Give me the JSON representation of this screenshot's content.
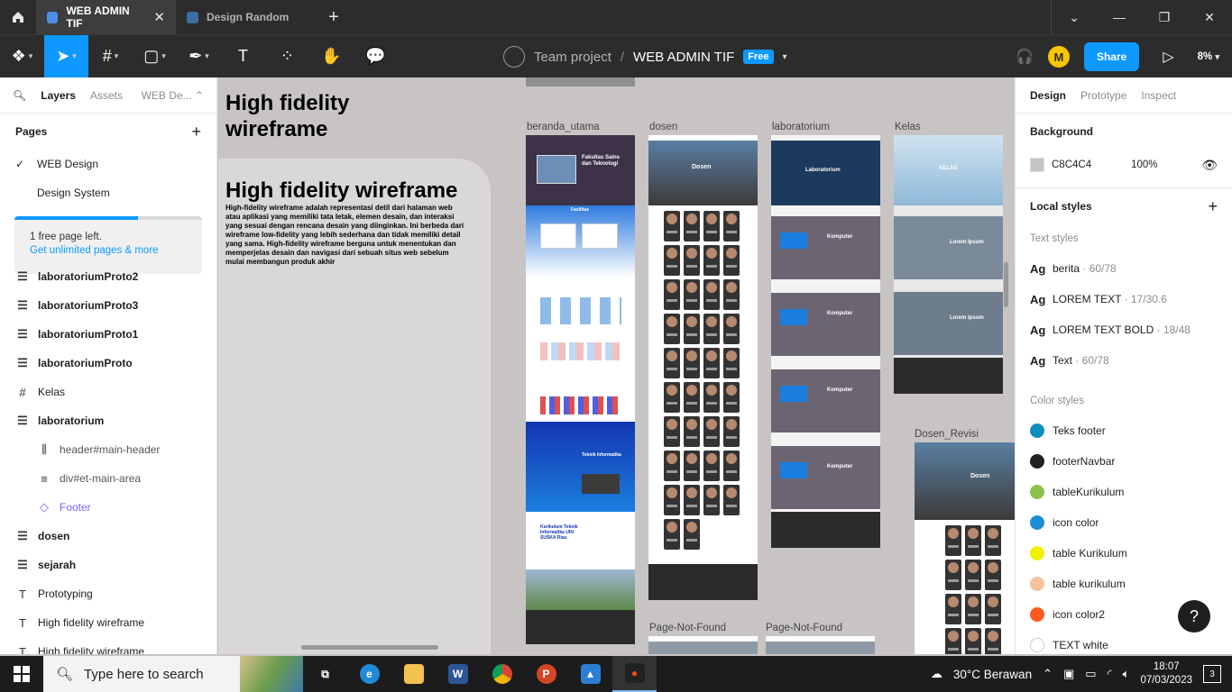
{
  "tabs": [
    {
      "label": "WEB ADMIN TIF",
      "active": true
    },
    {
      "label": "Design Random",
      "active": false
    }
  ],
  "toolbar": {
    "team": "Team project",
    "separator": "/",
    "file": "WEB ADMIN TIF",
    "plan_badge": "Free",
    "user_initial": "M",
    "share_label": "Share",
    "zoom": "8%"
  },
  "left_panel": {
    "tab_layers": "Layers",
    "tab_assets": "Assets",
    "page_dropdown": "WEB De...",
    "pages_heading": "Pages",
    "pages": [
      {
        "label": "WEB Design",
        "current": true
      },
      {
        "label": "Design System",
        "current": false
      }
    ],
    "banner_text": "1 free page left.",
    "banner_link": "Get unlimited pages & more",
    "banner_progress": 0.66,
    "layers": [
      {
        "label": "laboratoriumProto2",
        "icon": "frame-lines-icon",
        "kind": "bold"
      },
      {
        "label": "laboratoriumProto3",
        "icon": "frame-lines-icon",
        "kind": "bold"
      },
      {
        "label": "laboratoriumProto1",
        "icon": "frame-lines-icon",
        "kind": "bold"
      },
      {
        "label": "laboratoriumProto",
        "icon": "frame-lines-icon",
        "kind": "bold"
      },
      {
        "label": "Kelas",
        "icon": "frame-hash-icon",
        "kind": "normal"
      },
      {
        "label": "laboratorium",
        "icon": "frame-lines-icon",
        "kind": "bold"
      },
      {
        "label": "header#main-header",
        "icon": "columns-icon",
        "kind": "child"
      },
      {
        "label": "div#et-main-area",
        "icon": "rows-icon",
        "kind": "child"
      },
      {
        "label": "Footer",
        "icon": "component-icon",
        "kind": "child-comp"
      },
      {
        "label": "dosen",
        "icon": "frame-lines-icon",
        "kind": "bold"
      },
      {
        "label": "sejarah",
        "icon": "frame-lines-icon",
        "kind": "bold"
      },
      {
        "label": "Prototyping",
        "icon": "text-icon",
        "kind": "normal"
      },
      {
        "label": "High fidelity wireframe",
        "icon": "text-icon",
        "kind": "normal"
      },
      {
        "label": "High fidelity wireframe",
        "icon": "text-icon",
        "kind": "normal"
      }
    ]
  },
  "canvas": {
    "title": "High fidelity wireframe",
    "card_heading": "High fidelity wireframe",
    "card_body": "High-fidelity wireframe adalah representasi detil dari halaman web atau aplikasi yang memiliki tata letak, elemen desain, dan interaksi yang sesuai dengan rencana desain yang diinginkan. Ini berbeda dari wireframe low-fidelity yang lebih sederhana dan tidak memiliki detail yang sama. High-fidelity wireframe berguna untuk menentukan dan memperjelas desain dan navigasi dari sebuah situs web sebelum mulai membangun produk akhir",
    "frames": {
      "beranda": "beranda_utama",
      "dosen": "dosen",
      "laboratorium": "laboratorium",
      "kelas": "Kelas",
      "dosen_revisi": "Dosen_Revisi",
      "page_not_found_1": "Page-Not-Found",
      "page_not_found_2": "Page-Not-Found"
    },
    "beranda_texts": {
      "hero": "Fakultas Sains dan Teknologi",
      "fasilitas": "Fasilitas",
      "prodi": "Teknik Informatika",
      "kurikulum": "Kurikulum Teknik Informatika UIN SUSKA Riau"
    },
    "dosen_hero": "Dosen",
    "lab_hero": "Laboratorium",
    "lab_sections": [
      "Komputer",
      "Komputer",
      "Komputer",
      "Komputer"
    ],
    "kelas_hero": "KELAS",
    "kelas_sections": [
      "Lorem Ipsum",
      "Lorem Ipsum"
    ],
    "dosen_revisi_hero": "Dosen"
  },
  "right_panel": {
    "tab_design": "Design",
    "tab_prototype": "Prototype",
    "tab_inspect": "Inspect",
    "background_heading": "Background",
    "background_hex": "C8C4C4",
    "background_opacity": "100%",
    "background_color": "#c8c4c4",
    "local_styles_heading": "Local styles",
    "text_styles_heading": "Text styles",
    "text_styles": [
      {
        "glyph": "Ag",
        "name": "berita",
        "meta": " · 60/78"
      },
      {
        "glyph": "Ag",
        "name": "LOREM TEXT",
        "meta": " · 17/30.6"
      },
      {
        "glyph": "Ag",
        "name": "LOREM TEXT BOLD",
        "meta": " · 18/48"
      },
      {
        "glyph": "Ag",
        "name": "Text",
        "meta": " · 60/78"
      }
    ],
    "color_styles_heading": "Color styles",
    "color_styles": [
      {
        "name": "Teks footer",
        "color": "#0e8fbd"
      },
      {
        "name": "footerNavbar",
        "color": "#222222"
      },
      {
        "name": "tableKurikulum",
        "color": "#8bc34a"
      },
      {
        "name": "icon color",
        "color": "#1a8fd4"
      },
      {
        "name": "table Kurikulum",
        "color": "#f2f200"
      },
      {
        "name": "table kurikulum",
        "color": "#f5c29b"
      },
      {
        "name": "icon color2",
        "color": "#ff5a1f"
      },
      {
        "name": "TEXT white",
        "color": "#ffffff"
      }
    ],
    "help_label": "?"
  },
  "taskbar": {
    "search_placeholder": "Type here to search",
    "weather": "30°C  Berawan",
    "time": "18:07",
    "date": "07/03/2023",
    "notifications": "3"
  }
}
